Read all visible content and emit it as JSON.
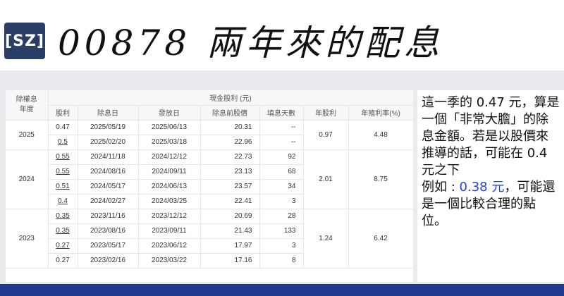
{
  "logo": {
    "text": "[SZ]"
  },
  "title": "00878 兩年來的配息",
  "table": {
    "header_left": "除權息\n年度",
    "group_header": "現金股利 (元)",
    "columns": [
      "股利",
      "除息日",
      "發放日",
      "除息前股價",
      "填息天數",
      "年股利",
      "年殖利率(%)"
    ],
    "groups": [
      {
        "year": "2025",
        "annual": "0.97",
        "yield": "4.48",
        "rows": [
          {
            "div": "0.47",
            "ex": "2025/05/19",
            "pay": "2025/06/13",
            "price": "20.31",
            "days": "--",
            "u": false
          },
          {
            "div": "0.5",
            "ex": "2025/02/20",
            "pay": "2025/03/18",
            "price": "22.96",
            "days": "--",
            "u": true
          }
        ]
      },
      {
        "year": "2024",
        "annual": "2.01",
        "yield": "8.75",
        "rows": [
          {
            "div": "0.55",
            "ex": "2024/11/18",
            "pay": "2024/12/12",
            "price": "22.73",
            "days": "92",
            "u": true
          },
          {
            "div": "0.55",
            "ex": "2024/08/16",
            "pay": "2024/09/11",
            "price": "23.13",
            "days": "68",
            "u": true
          },
          {
            "div": "0.51",
            "ex": "2024/05/17",
            "pay": "2024/06/13",
            "price": "23.57",
            "days": "34",
            "u": true
          },
          {
            "div": "0.4",
            "ex": "2024/02/27",
            "pay": "2024/03/25",
            "price": "22.41",
            "days": "3",
            "u": true
          }
        ]
      },
      {
        "year": "2023",
        "annual": "1.24",
        "yield": "6.42",
        "rows": [
          {
            "div": "0.35",
            "ex": "2023/11/16",
            "pay": "2023/12/12",
            "price": "20.69",
            "days": "28",
            "u": true
          },
          {
            "div": "0.35",
            "ex": "2023/08/16",
            "pay": "2023/09/11",
            "price": "21.43",
            "days": "133",
            "u": true
          },
          {
            "div": "0.27",
            "ex": "2023/05/17",
            "pay": "2023/06/12",
            "price": "17.97",
            "days": "3",
            "u": true
          },
          {
            "div": "0.27",
            "ex": "2023/02/16",
            "pay": "2023/03/22",
            "price": "17.16",
            "days": "8",
            "u": false
          }
        ]
      }
    ]
  },
  "note": {
    "p1": "這一季的 0.47 元，算是一個「非常大膽」的除息金額。若是以股價來推導的話，可能在 0.4 元之下",
    "p2_prefix": "例如 : ",
    "p2_highlight": "0.38 元",
    "p2_suffix": "，可能還是一個比較合理的點位。",
    "highlight_color": "#2346d6"
  }
}
